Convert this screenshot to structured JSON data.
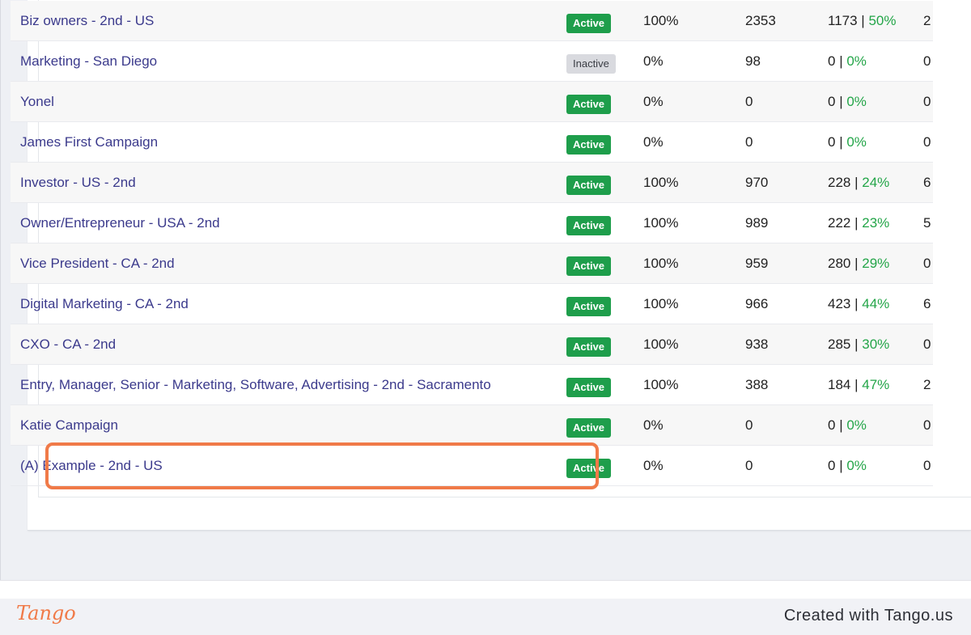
{
  "campaigns": [
    {
      "name": "Biz owners - 2nd - US",
      "status": "Active",
      "progress": "100%",
      "total": "2353",
      "accepted": "1173",
      "accepted_pct": "50%",
      "extra": "2"
    },
    {
      "name": "Marketing - San Diego",
      "status": "Inactive",
      "progress": "0%",
      "total": "98",
      "accepted": "0",
      "accepted_pct": "0%",
      "extra": "0"
    },
    {
      "name": "Yonel",
      "status": "Active",
      "progress": "0%",
      "total": "0",
      "accepted": "0",
      "accepted_pct": "0%",
      "extra": "0"
    },
    {
      "name": "James First Campaign",
      "status": "Active",
      "progress": "0%",
      "total": "0",
      "accepted": "0",
      "accepted_pct": "0%",
      "extra": "0"
    },
    {
      "name": "Investor - US - 2nd",
      "status": "Active",
      "progress": "100%",
      "total": "970",
      "accepted": "228",
      "accepted_pct": "24%",
      "extra": "6"
    },
    {
      "name": "Owner/Entrepreneur - USA - 2nd",
      "status": "Active",
      "progress": "100%",
      "total": "989",
      "accepted": "222",
      "accepted_pct": "23%",
      "extra": "5"
    },
    {
      "name": "Vice President - CA - 2nd",
      "status": "Active",
      "progress": "100%",
      "total": "959",
      "accepted": "280",
      "accepted_pct": "29%",
      "extra": "0"
    },
    {
      "name": "Digital Marketing - CA - 2nd",
      "status": "Active",
      "progress": "100%",
      "total": "966",
      "accepted": "423",
      "accepted_pct": "44%",
      "extra": "6"
    },
    {
      "name": "CXO - CA - 2nd",
      "status": "Active",
      "progress": "100%",
      "total": "938",
      "accepted": "285",
      "accepted_pct": "30%",
      "extra": "0"
    },
    {
      "name": "Entry, Manager, Senior - Marketing, Software, Advertising - 2nd - Sacramento",
      "status": "Active",
      "progress": "100%",
      "total": "388",
      "accepted": "184",
      "accepted_pct": "47%",
      "extra": "2"
    },
    {
      "name": "Katie Campaign",
      "status": "Active",
      "progress": "0%",
      "total": "0",
      "accepted": "0",
      "accepted_pct": "0%",
      "extra": "0"
    },
    {
      "name": "(A) Example - 2nd - US",
      "status": "Active",
      "progress": "0%",
      "total": "0",
      "accepted": "0",
      "accepted_pct": "0%",
      "extra": "0"
    }
  ],
  "accepted_separator": " | ",
  "footer": {
    "logo": "Tango",
    "created": "Created with Tango.us"
  },
  "colors": {
    "link": "#3b3a8c",
    "active_badge": "#1e9e4b",
    "inactive_badge": "#d9dadf",
    "percent_green": "#23a548",
    "highlight": "#f07a48"
  }
}
